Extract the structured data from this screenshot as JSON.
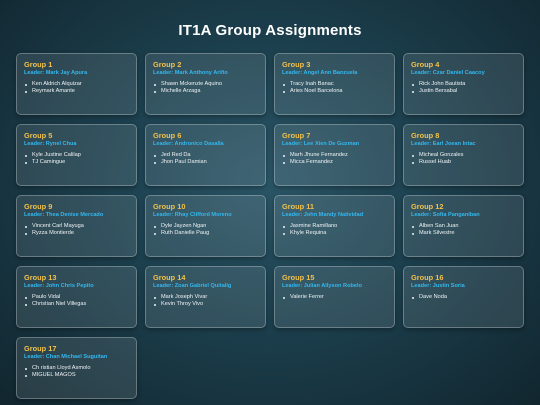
{
  "title": "IT1A Group Assignments",
  "colors": {
    "group_name": "#f2c14a",
    "leader": "#34b8ef",
    "member": "#f0f4f6"
  },
  "groups": [
    {
      "name": "Group 1",
      "leader": "Leader: Mark Jay Apura",
      "members": [
        "Ken Aldrich Alquizar",
        "Reymark Amante"
      ]
    },
    {
      "name": "Group 2",
      "leader": "Leader: Mark Anthony Ariño",
      "members": [
        "Shawn Mckenzie Aquino",
        "Michelle Arzaga"
      ]
    },
    {
      "name": "Group 3",
      "leader": "Leader: Angel Ann Banzuela",
      "members": [
        "Tracy Inah Banac",
        "Aries Noel Barcelona"
      ]
    },
    {
      "name": "Group 4",
      "leader": "Leader: Czar Daniel Caacoy",
      "members": [
        "Rick John Bautista",
        "Justin Bersabal"
      ]
    },
    {
      "name": "Group 5",
      "leader": "Leader: Rynel Chua",
      "members": [
        "Kyle Justine Calilap",
        "TJ Camingue"
      ]
    },
    {
      "name": "Group 6",
      "leader": "Leader: Andronico Dasalla",
      "members": [
        "Jed Red Da",
        "Jhon Paul Damian"
      ]
    },
    {
      "name": "Group 7",
      "leader": "Leader: Lee Xien De Guzman",
      "members": [
        "Marh Jhune Fernandez",
        "Micca Fernandez"
      ]
    },
    {
      "name": "Group 8",
      "leader": "Leader: Earl Joean Intac",
      "members": [
        "Micheal Gonzales",
        "Russel Huab"
      ]
    },
    {
      "name": "Group 9",
      "leader": "Leader: Thea Denise Mercado",
      "members": [
        "Vincent Carl Mayuga",
        "Ryzza Montierde"
      ]
    },
    {
      "name": "Group 10",
      "leader": "Leader: Rhay Clifford Moreno",
      "members": [
        "Dyle Jayzen Ngan",
        "Ruth Danielle Paug"
      ]
    },
    {
      "name": "Group 11",
      "leader": "Leader: John Mandy Natividad",
      "members": [
        "Jasmine Ramillano",
        "Khyle Requina"
      ]
    },
    {
      "name": "Group 12",
      "leader": "Leader: Sofia Panganiban",
      "members": [
        "Alben San Juan",
        "Mark Silvestre"
      ]
    },
    {
      "name": "Group 13",
      "leader": "Leader: John Chris Pepito",
      "members": [
        "Paulo Vidal",
        "Christian Niel Villegas"
      ]
    },
    {
      "name": "Group 14",
      "leader": "Leader: Zoan Gabriel Quitalig",
      "members": [
        "Mark Joseph Vivar",
        "Kevin Throy Vivo"
      ]
    },
    {
      "name": "Group 15",
      "leader": "Leader: Julian Allyson Robelo",
      "members": [
        "Valerie Ferrer"
      ]
    },
    {
      "name": "Group 16",
      "leader": "Leader: Justin Soria",
      "members": [
        "Dave Noda"
      ]
    },
    {
      "name": "Group 17",
      "leader": "Leader: Chan Michael Suguitan",
      "members": [
        "Ch ristian Lloyd Asmolo",
        "MIGUEL MAGOS"
      ]
    }
  ]
}
